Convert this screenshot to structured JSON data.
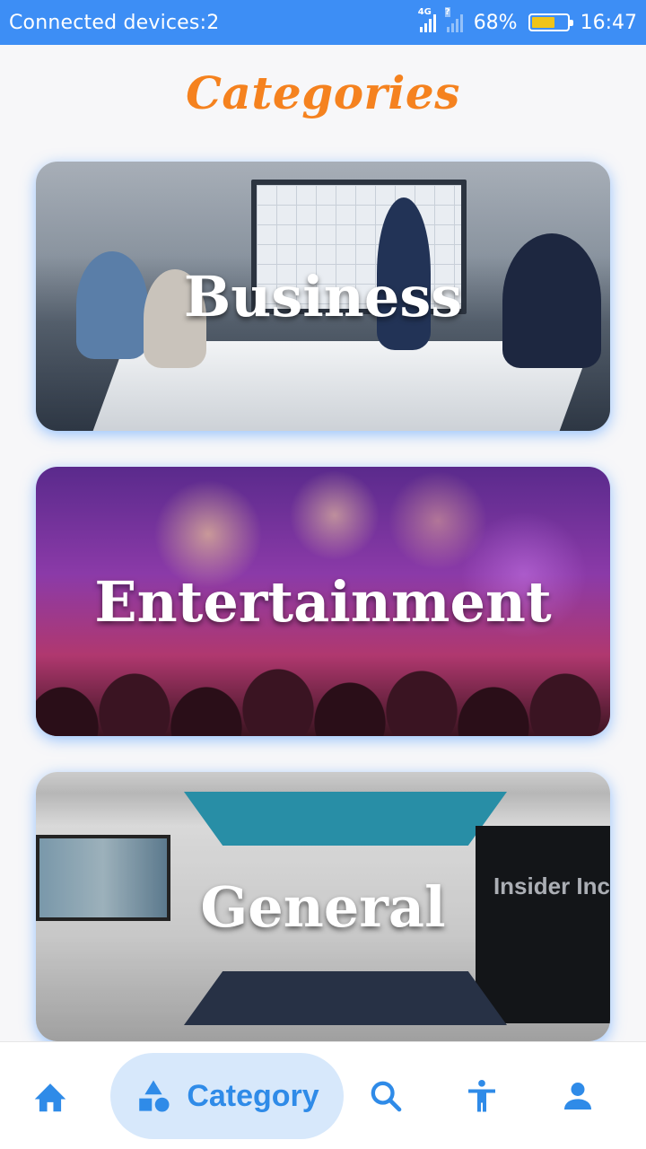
{
  "status_bar": {
    "left_text": "Connected devices:2",
    "network_tag": "4G",
    "sim2_tag": "?",
    "battery_text": "68%",
    "battery_level": 0.68,
    "time": "16:47"
  },
  "page": {
    "title": "Categories",
    "title_color": "#f5821f"
  },
  "categories": [
    {
      "label": "Business"
    },
    {
      "label": "Entertainment"
    },
    {
      "label": "General"
    }
  ],
  "general_card": {
    "wall_text": "Insider Inc"
  },
  "bottom_nav": {
    "active_color": "#2f8be8",
    "items": [
      {
        "icon": "home-icon"
      },
      {
        "icon": "category-icon",
        "label": "Category"
      },
      {
        "icon": "search-icon"
      },
      {
        "icon": "accessibility-icon"
      },
      {
        "icon": "profile-icon"
      }
    ]
  }
}
